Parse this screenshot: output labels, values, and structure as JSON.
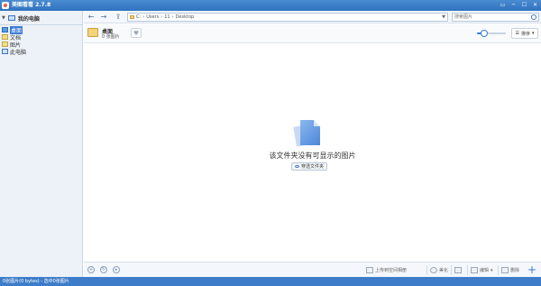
{
  "window": {
    "title": "美图看看 2.7.8",
    "controls": [
      "▭",
      "─",
      "☐",
      "✕"
    ]
  },
  "sidebar": {
    "root_label": "我的电脑",
    "items": [
      {
        "label": "桌面",
        "icon": "desktop-folder-icon",
        "selected": true
      },
      {
        "label": "文档",
        "icon": "documents-folder-icon",
        "selected": false
      },
      {
        "label": "图片",
        "icon": "pictures-folder-icon",
        "selected": false
      },
      {
        "label": "此电脑",
        "icon": "computer-icon",
        "selected": false
      }
    ]
  },
  "toolbar": {
    "back": "←",
    "forward": "→",
    "up": "⇪",
    "address": {
      "drive": "C:",
      "parts": [
        "Users",
        "11",
        "Desktop"
      ],
      "sep": "›"
    },
    "search_placeholder": "搜索图片"
  },
  "folder_header": {
    "name": "桌面",
    "count": "0 张图片",
    "sort_label": "排序",
    "zoom_fraction": 0.25
  },
  "main": {
    "empty_message": "该文件夹没有可显示的图片",
    "show_button": "穿透文件夹"
  },
  "bottom": {
    "upload_label": "上传到空间相册",
    "beautify_label": "美化",
    "edit_label": "编辑",
    "delete_label": "删除"
  },
  "status": {
    "text": "0张图片(0 bytes) - 选中0张图片"
  }
}
